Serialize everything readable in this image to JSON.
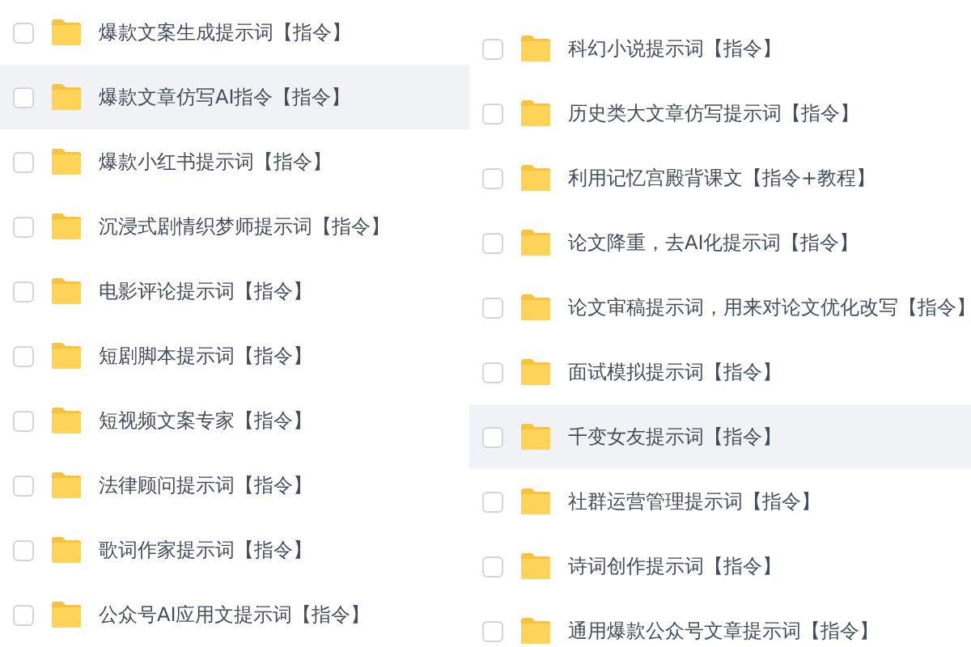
{
  "columns": [
    {
      "items": [
        {
          "name": "爆款文案生成提示词【指令】",
          "checked": false,
          "highlighted": false
        },
        {
          "name": "爆款文章仿写AI指令【指令】",
          "checked": false,
          "highlighted": true
        },
        {
          "name": "爆款小红书提示词【指令】",
          "checked": false,
          "highlighted": false
        },
        {
          "name": "沉浸式剧情织梦师提示词【指令】",
          "checked": false,
          "highlighted": false
        },
        {
          "name": "电影评论提示词【指令】",
          "checked": false,
          "highlighted": false
        },
        {
          "name": "短剧脚本提示词【指令】",
          "checked": false,
          "highlighted": false
        },
        {
          "name": "短视频文案专家【指令】",
          "checked": false,
          "highlighted": false
        },
        {
          "name": "法律顾问提示词【指令】",
          "checked": false,
          "highlighted": false
        },
        {
          "name": "歌词作家提示词【指令】",
          "checked": false,
          "highlighted": false
        },
        {
          "name": "公众号AI应用文提示词【指令】",
          "checked": false,
          "highlighted": false
        }
      ]
    },
    {
      "items": [
        {
          "name": "科幻小说提示词【指令】",
          "checked": false,
          "highlighted": false
        },
        {
          "name": "历史类大文章仿写提示词【指令】",
          "checked": false,
          "highlighted": false
        },
        {
          "name": "利用记忆宫殿背课文【指令+教程】",
          "checked": false,
          "highlighted": false
        },
        {
          "name": "论文降重，去AI化提示词【指令】",
          "checked": false,
          "highlighted": false
        },
        {
          "name": "论文审稿提示词，用来对论文优化改写【指令】",
          "checked": false,
          "highlighted": false
        },
        {
          "name": "面试模拟提示词【指令】",
          "checked": false,
          "highlighted": false
        },
        {
          "name": "千变女友提示词【指令】",
          "checked": false,
          "highlighted": true
        },
        {
          "name": "社群运营管理提示词【指令】",
          "checked": false,
          "highlighted": false
        },
        {
          "name": "诗词创作提示词【指令】",
          "checked": false,
          "highlighted": false
        },
        {
          "name": "通用爆款公众号文章提示词【指令】",
          "checked": false,
          "highlighted": false
        }
      ]
    }
  ]
}
